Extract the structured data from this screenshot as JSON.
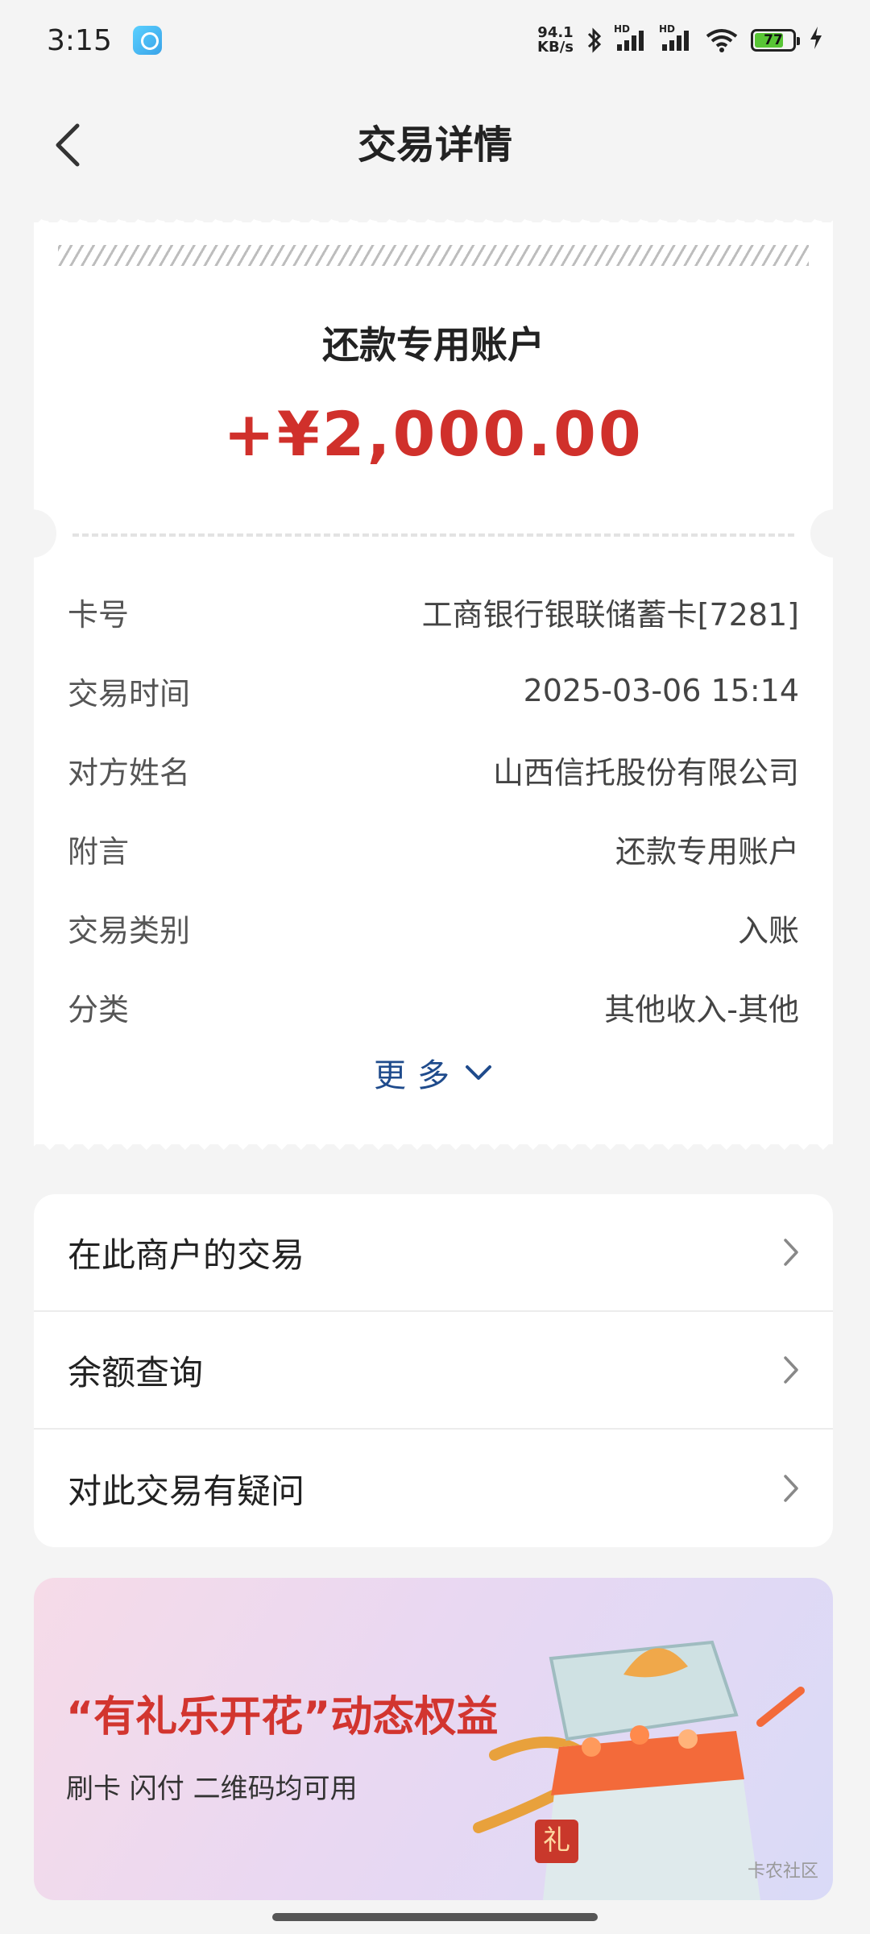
{
  "status_bar": {
    "time": "3:15",
    "net_speed_top": "94.1",
    "net_speed_bottom": "KB/s",
    "sim1_label": "HD",
    "sim2_label": "HD",
    "battery": "77"
  },
  "header": {
    "title": "交易详情",
    "back_icon": "chevron-left-icon"
  },
  "receipt": {
    "account_title": "还款专用账户",
    "amount": "+¥2,000.00",
    "amount_color": "#d0302b",
    "details": [
      {
        "label": "卡号",
        "value": "工商银行银联储蓄卡[7281]"
      },
      {
        "label": "交易时间",
        "value": "2025-03-06 15:14"
      },
      {
        "label": "对方姓名",
        "value": "山西信托股份有限公司"
      },
      {
        "label": "附言",
        "value": "还款专用账户"
      },
      {
        "label": "交易类别",
        "value": "入账"
      },
      {
        "label": "分类",
        "value": "其他收入-其他"
      }
    ],
    "more_label": "更多",
    "more_color": "#1f4b8c"
  },
  "menu": {
    "items": [
      {
        "label": "在此商户的交易"
      },
      {
        "label": "余额查询"
      },
      {
        "label": "对此交易有疑问"
      }
    ]
  },
  "banner": {
    "title": "“有礼乐开花”动态权益",
    "subtitle": "刷卡 闪付 二维码均可用",
    "gift_char": "礼",
    "watermark": "卡农社区"
  }
}
